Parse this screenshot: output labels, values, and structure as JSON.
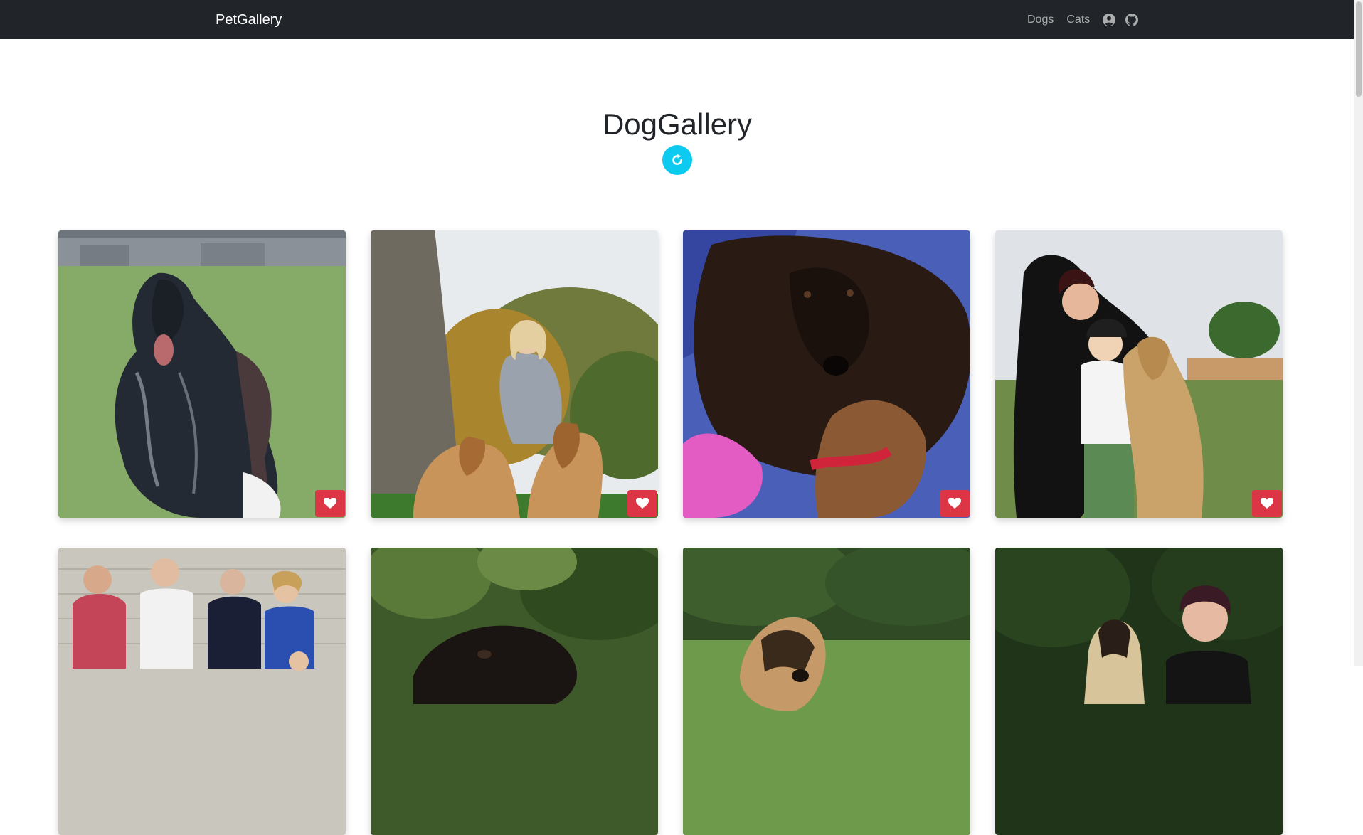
{
  "navbar": {
    "brand": "PetGallery",
    "links": [
      {
        "label": "Dogs"
      },
      {
        "label": "Cats"
      }
    ],
    "icons": [
      "user-circle-icon",
      "github-icon"
    ]
  },
  "hero": {
    "title": "DogGallery",
    "refresh_icon": "refresh-icon"
  },
  "gallery": {
    "images": [
      {
        "subject": "black afghan hound running on grass"
      },
      {
        "subject": "woman with two golden afghan hounds by ruins"
      },
      {
        "subject": "black afghan hound lying with plush toys"
      },
      {
        "subject": "woman and child with golden afghan hound"
      },
      {
        "subject": "group of people at dog show"
      },
      {
        "subject": "dark afghan hound close-up with foliage"
      },
      {
        "subject": "afghan hound on grass"
      },
      {
        "subject": "woman with blonde afghan hound by hedge"
      }
    ],
    "like_icon": "heart-icon"
  },
  "colors": {
    "navbar_bg": "#212529",
    "refresh_button": "#0dcaf0",
    "like_button": "#dc3545"
  }
}
